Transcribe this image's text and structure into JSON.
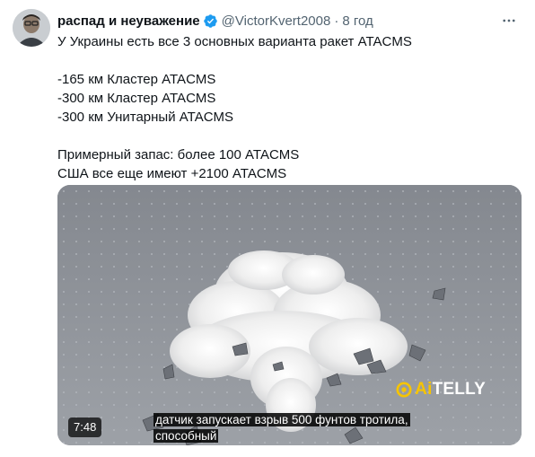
{
  "tweet": {
    "author_name": "распад и неуважение",
    "handle": "@VictorKvert2008",
    "separator": "·",
    "time": "8 год",
    "text_lines": [
      "У Украины есть все 3 основных варианта ракет ATACMS",
      "",
      "-165 км Кластер ATACMS",
      "-300 км Кластер ATACMS",
      "-300 км Унитарный ATACMS",
      "",
      "Примерный запас: более 100 ATACMS",
      "США все еще имеют +2100 ATACMS"
    ],
    "media": {
      "duration": "7:48",
      "subtitle_line1": "датчик запускает взрыв 500 фунтов тротила,",
      "subtitle_line2": "способный",
      "logo_ai": "Ai",
      "logo_rest": "TELLY"
    }
  },
  "colors": {
    "verified": "#1d9bf0",
    "muted": "#536471",
    "logo_yellow": "#f6c400"
  },
  "icons": [
    "avatar",
    "verified-badge-icon",
    "more-icon",
    "aitelly-logo-icon"
  ]
}
